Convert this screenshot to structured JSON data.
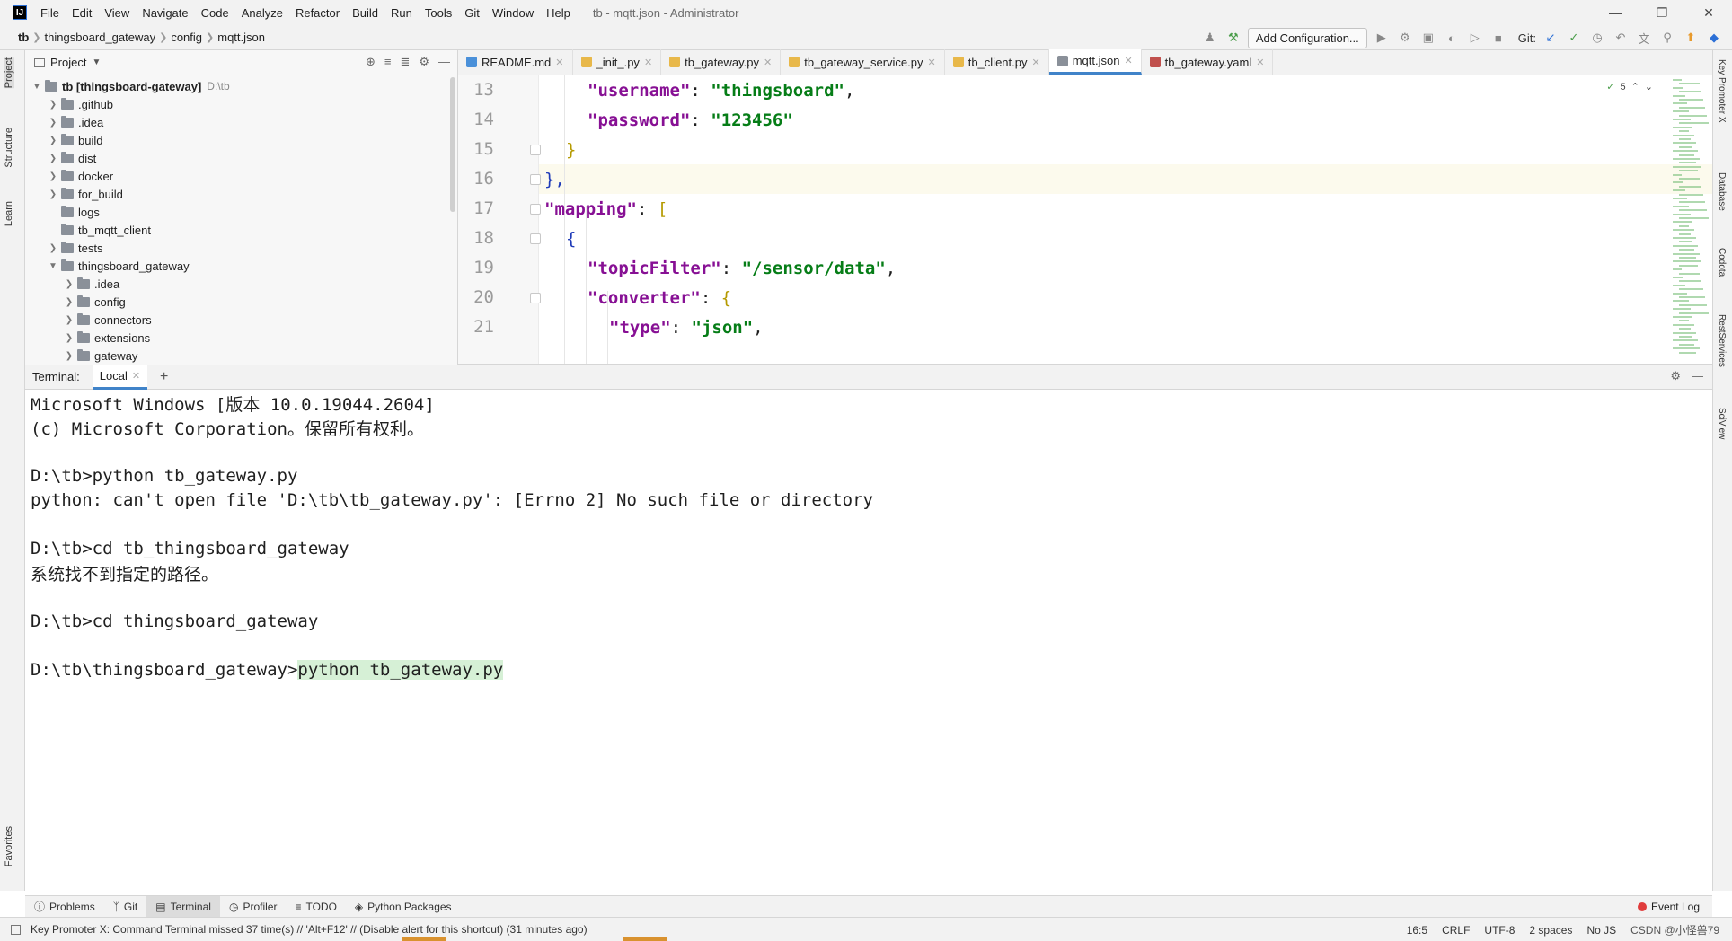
{
  "window": {
    "title": "tb - mqtt.json - Administrator",
    "logo": "IJ",
    "menu": [
      "File",
      "Edit",
      "View",
      "Navigate",
      "Code",
      "Analyze",
      "Refactor",
      "Build",
      "Run",
      "Tools",
      "Git",
      "Window",
      "Help"
    ],
    "controls": [
      "minimize-icon",
      "restore-icon",
      "close-icon"
    ]
  },
  "navbar": {
    "breadcrumbs": [
      "tb",
      "thingsboard_gateway",
      "config",
      "mqtt.json"
    ],
    "add_config": "Add Configuration...",
    "git_label": "Git:"
  },
  "left_strip": {
    "labels": [
      "Project",
      "Structure",
      "Learn",
      "Favorites"
    ]
  },
  "right_strip": {
    "labels": [
      "Key Promoter X",
      "Database",
      "Codota",
      "RestServices",
      "SciView"
    ]
  },
  "project": {
    "header": "Project",
    "root": {
      "label": "tb [thingsboard-gateway]",
      "path": "D:\\tb"
    },
    "items": [
      {
        "label": ".github",
        "level": 1,
        "expandable": true
      },
      {
        "label": ".idea",
        "level": 1,
        "expandable": true
      },
      {
        "label": "build",
        "level": 1,
        "expandable": true
      },
      {
        "label": "dist",
        "level": 1,
        "expandable": true
      },
      {
        "label": "docker",
        "level": 1,
        "expandable": true
      },
      {
        "label": "for_build",
        "level": 1,
        "expandable": true
      },
      {
        "label": "logs",
        "level": 1,
        "expandable": false
      },
      {
        "label": "tb_mqtt_client",
        "level": 1,
        "expandable": false
      },
      {
        "label": "tests",
        "level": 1,
        "expandable": true
      },
      {
        "label": "thingsboard_gateway",
        "level": 1,
        "expandable": true,
        "expanded": true
      },
      {
        "label": ".idea",
        "level": 2,
        "expandable": true
      },
      {
        "label": "config",
        "level": 2,
        "expandable": true
      },
      {
        "label": "connectors",
        "level": 2,
        "expandable": true
      },
      {
        "label": "extensions",
        "level": 2,
        "expandable": true
      },
      {
        "label": "gateway",
        "level": 2,
        "expandable": true
      }
    ]
  },
  "editor": {
    "tabs": [
      {
        "label": "README.md",
        "color": "#4a90d9",
        "active": false
      },
      {
        "label": "_init_.py",
        "color": "#e8b84a",
        "active": false
      },
      {
        "label": "tb_gateway.py",
        "color": "#e8b84a",
        "active": false
      },
      {
        "label": "tb_gateway_service.py",
        "color": "#e8b84a",
        "active": false
      },
      {
        "label": "tb_client.py",
        "color": "#e8b84a",
        "active": false
      },
      {
        "label": "mqtt.json",
        "color": "#8a9099",
        "active": true
      },
      {
        "label": "tb_gateway.yaml",
        "color": "#c0504d",
        "active": false
      }
    ],
    "inspection_count": "5",
    "lines": [
      13,
      14,
      15,
      16,
      17,
      18,
      19,
      20,
      21
    ],
    "code": {
      "l13_key": "\"username\"",
      "l13_val": "\"thingsboard\"",
      "l14_key": "\"password\"",
      "l14_val": "\"123456\"",
      "l15": "}",
      "l16": "},",
      "l17_key": "\"mapping\"",
      "l17_open": "[",
      "l18": "{",
      "l19_key": "\"topicFilter\"",
      "l19_val": "\"/sensor/data\"",
      "l20_key": "\"converter\"",
      "l20_open": "{",
      "l21_key": "\"type\"",
      "l21_val": "\"json\""
    }
  },
  "terminal": {
    "label": "Terminal:",
    "tab": "Local",
    "lines": [
      "Microsoft Windows [版本 10.0.19044.2604]",
      "(c) Microsoft Corporation。保留所有权利。",
      "",
      "D:\\tb>python tb_gateway.py",
      "python: can't open file 'D:\\tb\\tb_gateway.py': [Errno 2] No such file or directory",
      "",
      "D:\\tb>cd tb_thingsboard_gateway",
      "系统找不到指定的路径。",
      "",
      "D:\\tb>cd thingsboard_gateway",
      ""
    ],
    "prompt": "D:\\tb\\thingsboard_gateway>",
    "current_command": "python tb_gateway.py"
  },
  "tool_tabs": [
    {
      "label": "Problems",
      "icon": "problems-icon",
      "active": false
    },
    {
      "label": "Git",
      "icon": "git-icon",
      "active": false
    },
    {
      "label": "Terminal",
      "icon": "terminal-icon",
      "active": true
    },
    {
      "label": "Profiler",
      "icon": "profiler-icon",
      "active": false
    },
    {
      "label": "TODO",
      "icon": "todo-icon",
      "active": false
    },
    {
      "label": "Python Packages",
      "icon": "packages-icon",
      "active": false
    }
  ],
  "event_log": "Event Log",
  "status": {
    "message": "Key Promoter X: Command Terminal missed 37 time(s) // 'Alt+F12' // (Disable alert for this shortcut) (31 minutes ago)",
    "position": "16:5",
    "line_sep": "CRLF",
    "encoding": "UTF-8",
    "indent": "2 spaces",
    "schema": "No JS",
    "watermark": "CSDN @小怪兽79"
  }
}
